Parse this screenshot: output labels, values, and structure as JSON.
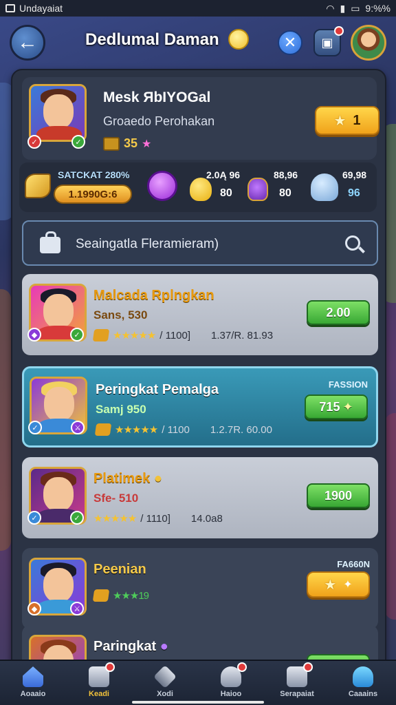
{
  "status_bar": {
    "app_name": "Undayaiat",
    "battery": "9:%%"
  },
  "header": {
    "title": "Dedlumal Daman"
  },
  "profile": {
    "name": "Mesk ЯbIYOGal",
    "subtitle": "Groaedo Perohakan",
    "coins": "35",
    "action_button": "1"
  },
  "stats": {
    "label": "SATCKAT 280%",
    "banner_value": "1.1990G:6",
    "items": [
      {
        "top": "2.0Ą 96",
        "bottom": "80"
      },
      {
        "top": "88,96",
        "bottom": "80"
      },
      {
        "top": "69,98",
        "bottom": "96"
      }
    ]
  },
  "search": {
    "placeholder": "Seaingatla Fleramieram)"
  },
  "rows": [
    {
      "name": "Malcada Rplngkan",
      "sub": "Sans, 530",
      "rating": "★★★★★",
      "count": "/ 1100]",
      "value": "1.37/R. 81.93",
      "button": "2.00"
    },
    {
      "name": "Peringkat Pemalga",
      "sub": "Samj 950",
      "rating": "★★★★★",
      "count": "/ 1100",
      "value": "1.2.7R. 60.00",
      "button": "715",
      "pass": "FASSION"
    },
    {
      "name": "Platimek",
      "sub": "Sfe- 510",
      "rating": "★★★★★",
      "count": "/ 1110]",
      "value": "14.0a8",
      "button": "1900"
    },
    {
      "name": "Peenian",
      "rating": "★★★19",
      "pass": "FA660N"
    },
    {
      "name": "Paringkat"
    }
  ],
  "bottom_nav": [
    {
      "label": "Aoaaio"
    },
    {
      "label": "Keadi",
      "active": true
    },
    {
      "label": "Xodi"
    },
    {
      "label": "Haioo"
    },
    {
      "label": "Serapaiat"
    },
    {
      "label": "Caaains"
    }
  ],
  "colors": {
    "accent_gold": "#f0a21a",
    "accent_green": "#38a834",
    "panel_bg": "#2b3344"
  }
}
